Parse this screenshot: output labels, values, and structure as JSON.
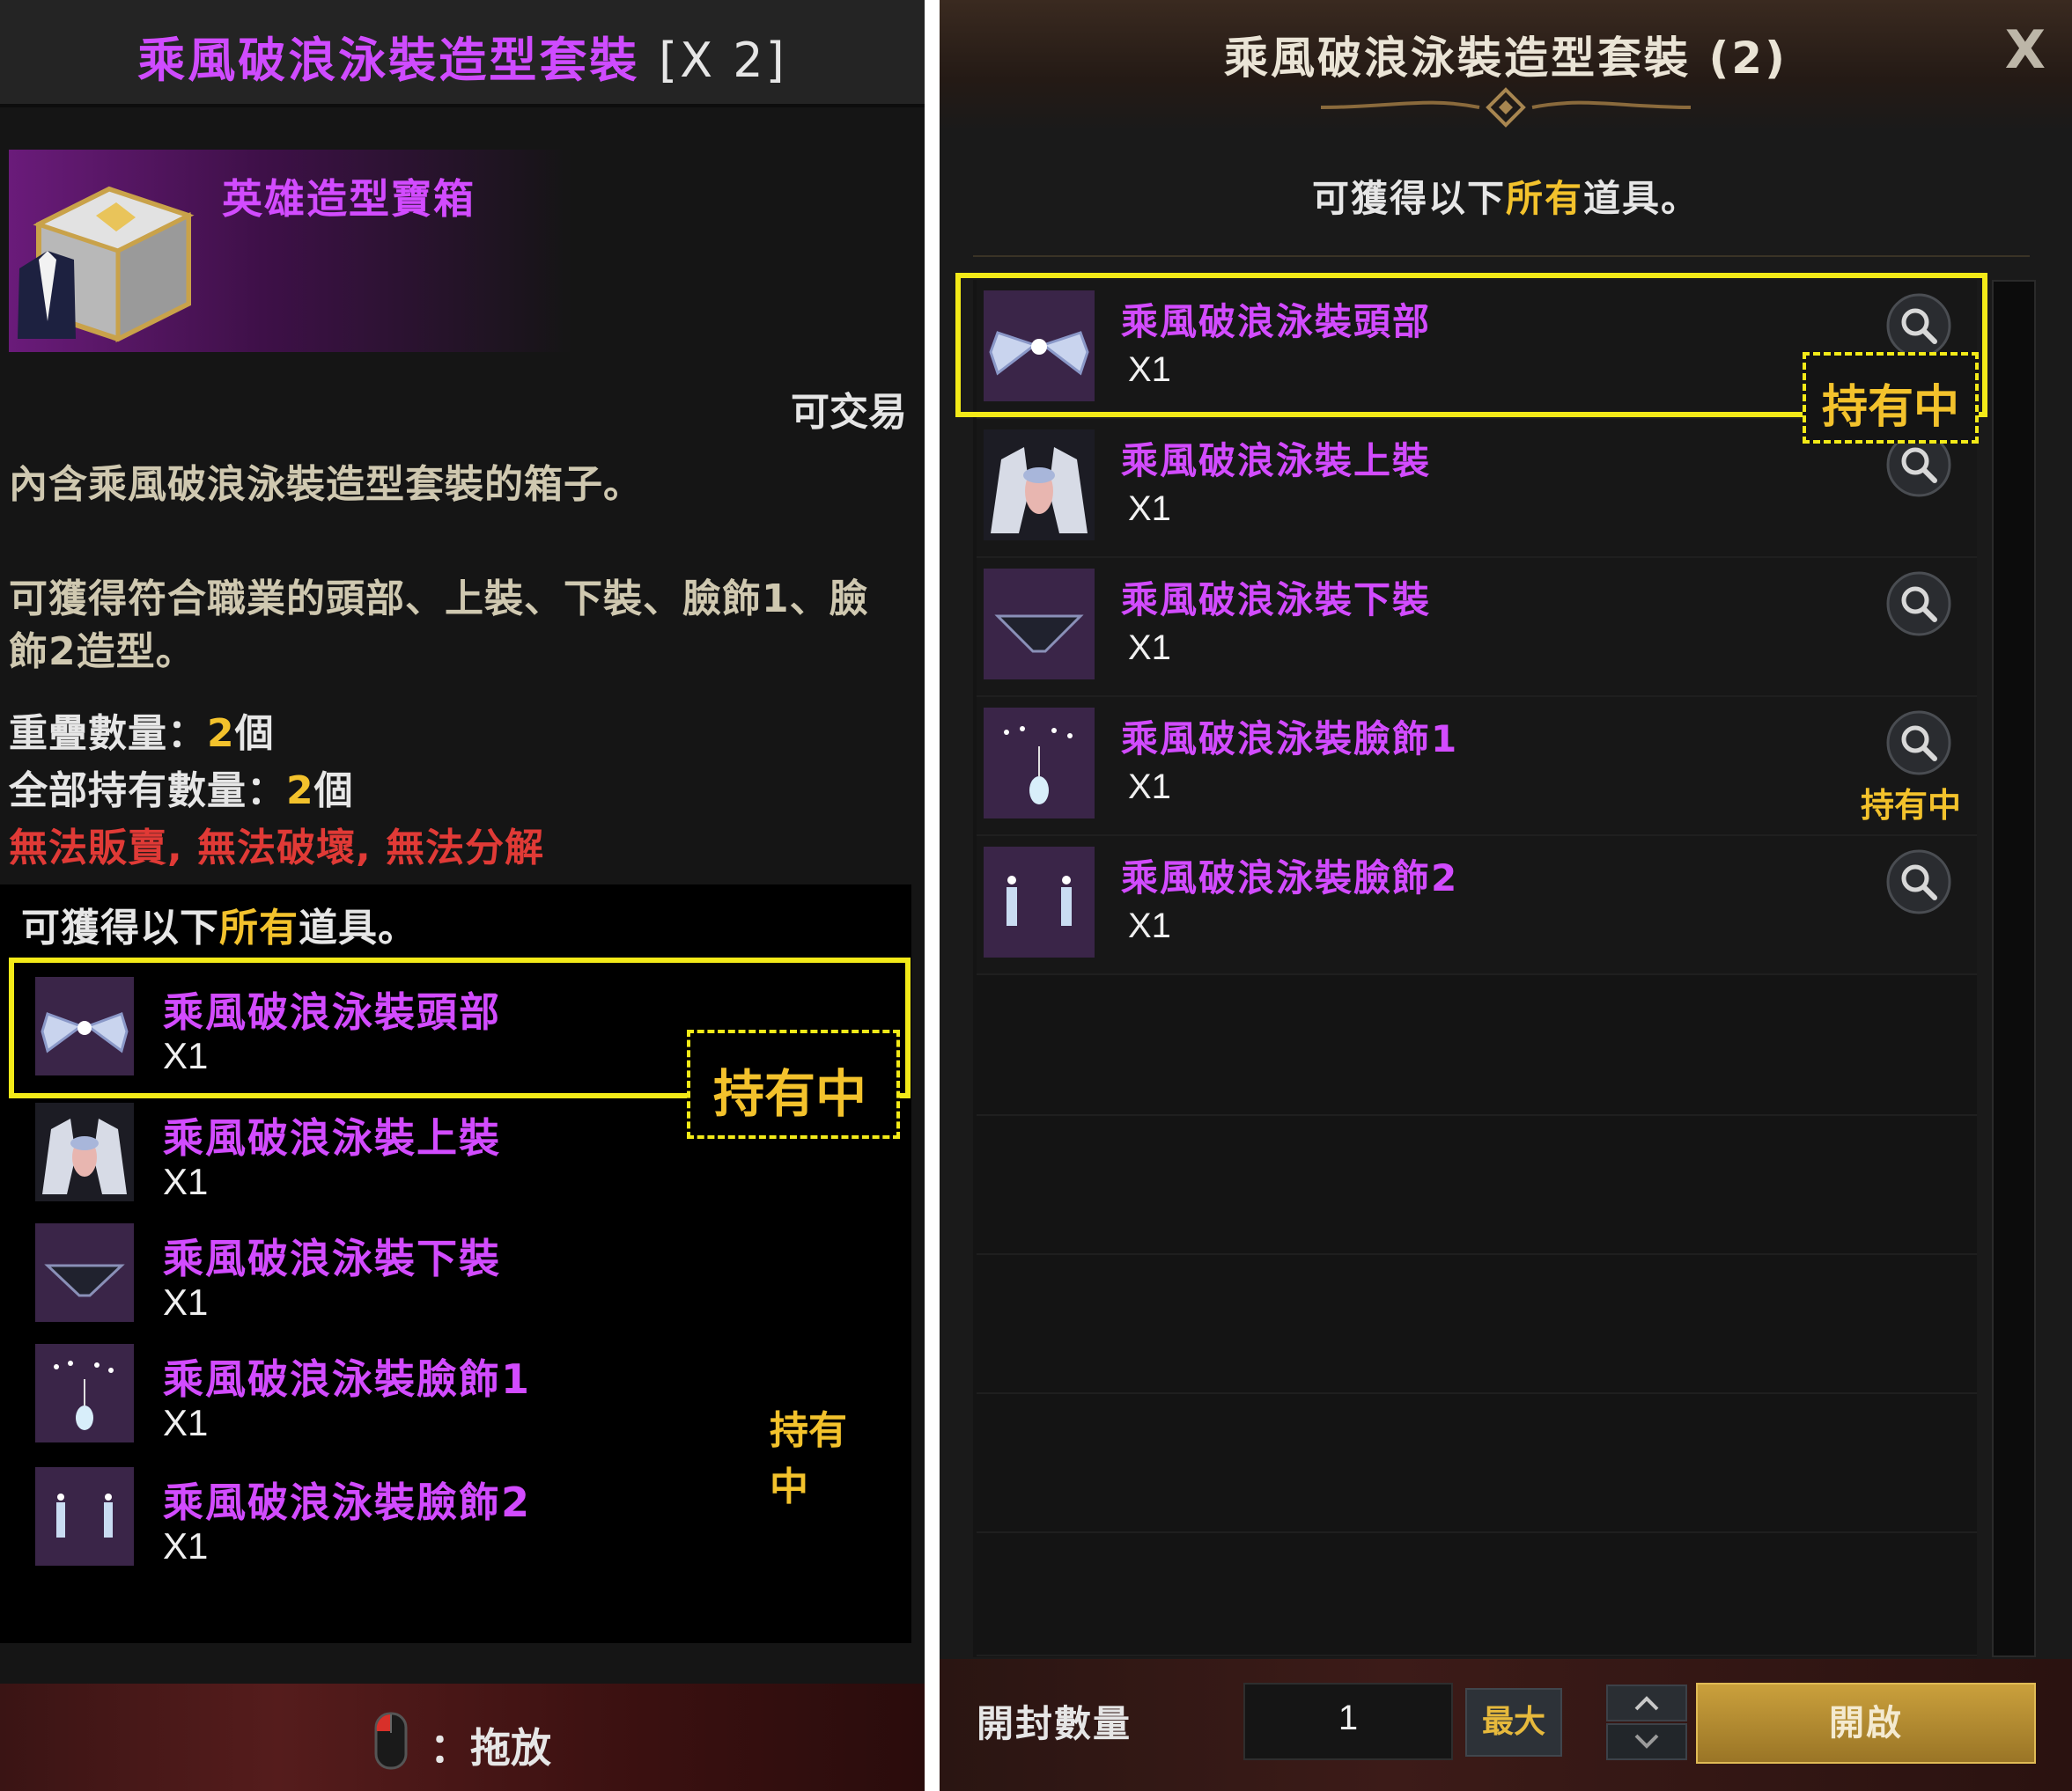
{
  "left_tooltip": {
    "title": "乘風破浪泳裝造型套裝",
    "title_count": "[X 2]",
    "hero_box_name": "英雄造型寶箱",
    "tradable": "可交易",
    "desc1": "內含乘風破浪泳裝造型套裝的箱子。",
    "desc2_line1": "可獲得符合職業的頭部、上裝、下裝、臉飾1、臉",
    "desc2_line2": "飾2造型。",
    "stack_label": "重疊數量：",
    "stack_value": "2",
    "stack_unit": "個",
    "owned_label": "全部持有數量：",
    "owned_value": "2",
    "owned_unit": "個",
    "restrictions": "無法販賣, 無法破壞, 無法分解",
    "list_header_pre": "可獲得以下",
    "list_header_gold": "所有",
    "list_header_post": "道具。",
    "items": [
      {
        "name": "乘風破浪泳裝頭部",
        "qty": "X1",
        "owned": "持有中",
        "icon": "hair-bow-icon"
      },
      {
        "name": "乘風破浪泳裝上裝",
        "qty": "X1",
        "owned": "",
        "icon": "swimsuit-top-icon"
      },
      {
        "name": "乘風破浪泳裝下裝",
        "qty": "X1",
        "owned": "",
        "icon": "swimsuit-bottom-icon"
      },
      {
        "name": "乘風破浪泳裝臉飾1",
        "qty": "X1",
        "owned": "持有中",
        "icon": "pendant-icon"
      },
      {
        "name": "乘風破浪泳裝臉飾2",
        "qty": "X1",
        "owned": "",
        "icon": "earrings-icon"
      }
    ],
    "footer_label": "：拖放"
  },
  "right_window": {
    "title": "乘風破浪泳裝造型套裝 (2)",
    "close": "X",
    "subtitle_pre": "可獲得以下",
    "subtitle_gold": "所有",
    "subtitle_post": "道具。",
    "items": [
      {
        "name": "乘風破浪泳裝頭部",
        "qty": "X1",
        "owned": "持有中",
        "icon": "hair-bow-icon"
      },
      {
        "name": "乘風破浪泳裝上裝",
        "qty": "X1",
        "owned": "",
        "icon": "swimsuit-top-icon"
      },
      {
        "name": "乘風破浪泳裝下裝",
        "qty": "X1",
        "owned": "",
        "icon": "swimsuit-bottom-icon"
      },
      {
        "name": "乘風破浪泳裝臉飾1",
        "qty": "X1",
        "owned": "持有中",
        "icon": "pendant-icon"
      },
      {
        "name": "乘風破浪泳裝臉飾2",
        "qty": "X1",
        "owned": "",
        "icon": "earrings-icon"
      }
    ],
    "open_qty_label": "開封數量",
    "open_qty_value": "1",
    "max_label": "最大",
    "open_label": "開啟"
  },
  "colors": {
    "item_name": "#d24bff",
    "highlight": "#f3ea18",
    "owned": "#f3c22c",
    "warning": "#e03a36"
  }
}
